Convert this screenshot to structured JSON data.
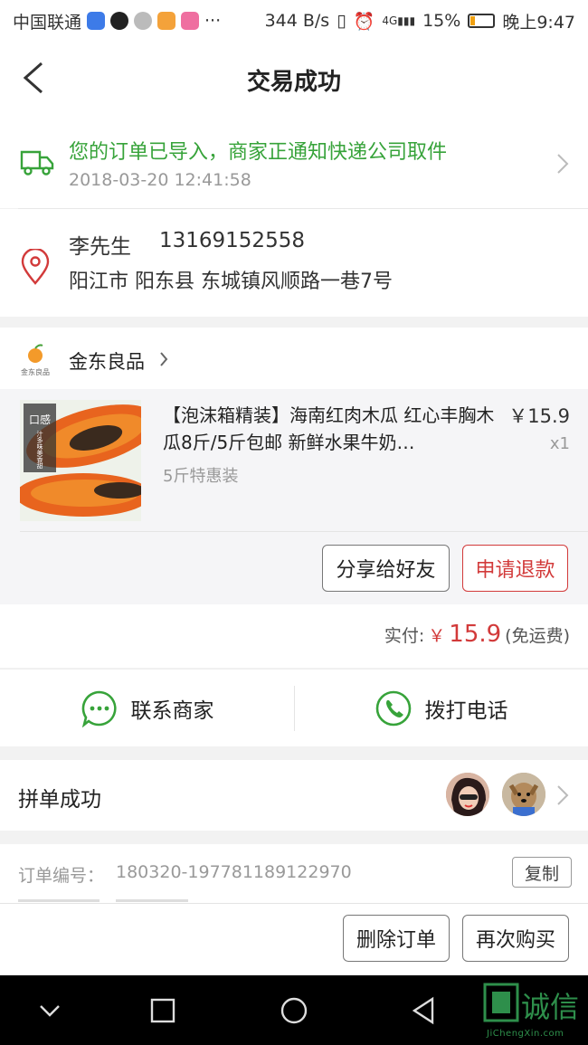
{
  "status_bar": {
    "carrier": "中国联通",
    "net_speed": "344 B/s",
    "signal": "4G",
    "battery": "15%",
    "time": "晚上9:47",
    "more": "···"
  },
  "header": {
    "title": "交易成功"
  },
  "logistics": {
    "message": "您的订单已导入，商家正通知快递公司取件",
    "timestamp": "2018-03-20 12:41:58"
  },
  "address": {
    "name": "李先生",
    "phone": "13169152558",
    "detail": "阳江市 阳东县 东城镇风顺路一巷7号"
  },
  "shop": {
    "name": "金东良品",
    "logo_caption": "金东良品"
  },
  "product": {
    "title": "【泡沫箱精装】海南红肉木瓜 红心丰胸木瓜8斤/5斤包邮 新鲜水果牛奶…",
    "price": "￥15.9",
    "quantity": "x1",
    "spec": "5斤特惠装",
    "badge": "口感",
    "badge_sub": "汁多味美香甜"
  },
  "actions": {
    "share": "分享给好友",
    "refund": "申请退款"
  },
  "total": {
    "label": "实付:",
    "currency": "￥",
    "amount": "15.9",
    "note": "(免运费)"
  },
  "contact": {
    "merchant": "联系商家",
    "call": "拨打电话"
  },
  "group": {
    "label": "拼单成功"
  },
  "order": {
    "number_label": "订单编号：",
    "number": "180320-197781189122970",
    "copy": "复制"
  },
  "bottom": {
    "delete": "删除订单",
    "rebuy": "再次购买"
  },
  "watermark": {
    "text": "诚信",
    "sub": "JiChengXin.com"
  },
  "colors": {
    "green": "#37a33a",
    "red": "#d23a3a",
    "text": "#222222",
    "muted": "#999999"
  }
}
